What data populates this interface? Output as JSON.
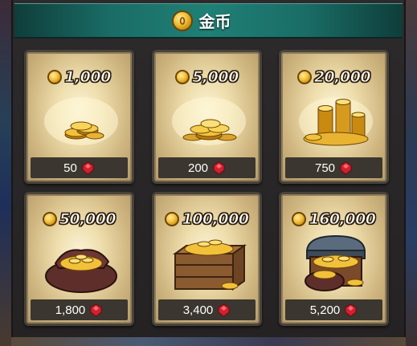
{
  "header": {
    "title": "金币"
  },
  "packs": [
    {
      "amount": "1,000",
      "price": "50",
      "art": "small-coin-stack"
    },
    {
      "amount": "5,000",
      "price": "200",
      "art": "coin-pile"
    },
    {
      "amount": "20,000",
      "price": "750",
      "art": "coin-stacks"
    },
    {
      "amount": "50,000",
      "price": "1,800",
      "art": "coin-sack"
    },
    {
      "amount": "100,000",
      "price": "3,400",
      "art": "coin-crate"
    },
    {
      "amount": "160,000",
      "price": "5,200",
      "art": "treasure-chest"
    }
  ],
  "colors": {
    "header_teal": "#1f8076",
    "card_bg": "#efdfae",
    "coin_gold": "#f2c13a",
    "ruby_red": "#d1202e"
  }
}
